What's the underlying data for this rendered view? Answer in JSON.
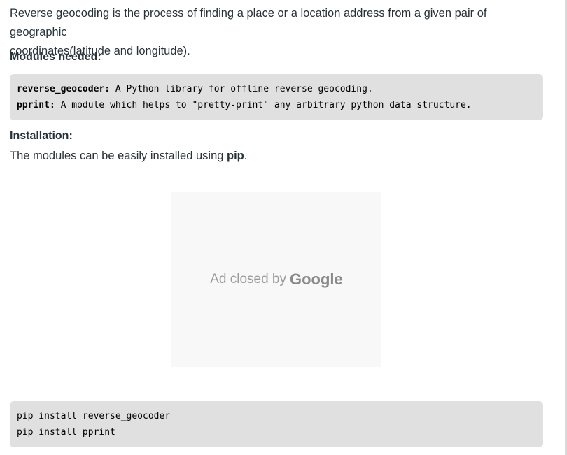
{
  "article": {
    "intro_line1": "Reverse geocoding is the process of finding a place or a location address from a given pair of geographic",
    "intro_line2": "coordinates(latitude and longitude).",
    "modules_heading": "Modules needed:",
    "modules_code": [
      {
        "name": "reverse_geocoder:",
        "desc": " A Python library for offline reverse geocoding."
      },
      {
        "name": "pprint:",
        "desc": " A module which helps to \"pretty-print\" any arbitrary python data structure."
      }
    ],
    "installation_heading": "Installation:",
    "installation_text_prefix": "The modules can be easily installed using ",
    "installation_text_bold": "pip",
    "installation_text_suffix": ".",
    "install_code": [
      "pip install reverse_geocoder",
      "pip install pprint"
    ]
  },
  "ad": {
    "closed_text": "Ad closed by",
    "brand": "Google"
  }
}
